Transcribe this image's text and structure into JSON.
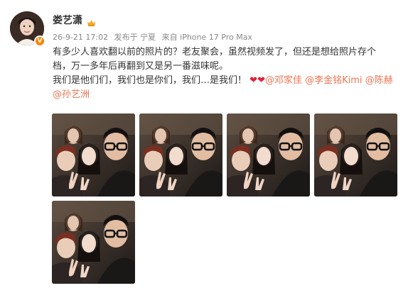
{
  "post": {
    "author": {
      "name": "娄艺潇",
      "verified_badge": "V",
      "member_icon": "crown-icon"
    },
    "meta": {
      "date": "26-9-21 17:02",
      "location": "发布于 宁夏",
      "source": "来自 iPhone 17 Pro Max"
    },
    "text": {
      "line1": "有多少人喜欢翻以前的照片的？老友聚会，虽然视频发了，但还是想给照片存个",
      "line2": "档，万一多年后再翻到又是另一番滋味呢。",
      "line3_prefix": "我们是他们们，我们也是你们，我们…是我们！",
      "hearts": "❤",
      "mentions": [
        "@邓家佳",
        "@李金铭Kimi",
        "@陈赫",
        "@孙艺洲"
      ]
    },
    "photos": [
      {
        "label": "photo-1"
      },
      {
        "label": "photo-2"
      },
      {
        "label": "photo-3"
      },
      {
        "label": "photo-4"
      },
      {
        "label": "photo-5"
      }
    ]
  },
  "colors": {
    "mention": "#eb7350",
    "meta": "#888888",
    "badge": "#ff8200",
    "heart": "#e0233a"
  }
}
